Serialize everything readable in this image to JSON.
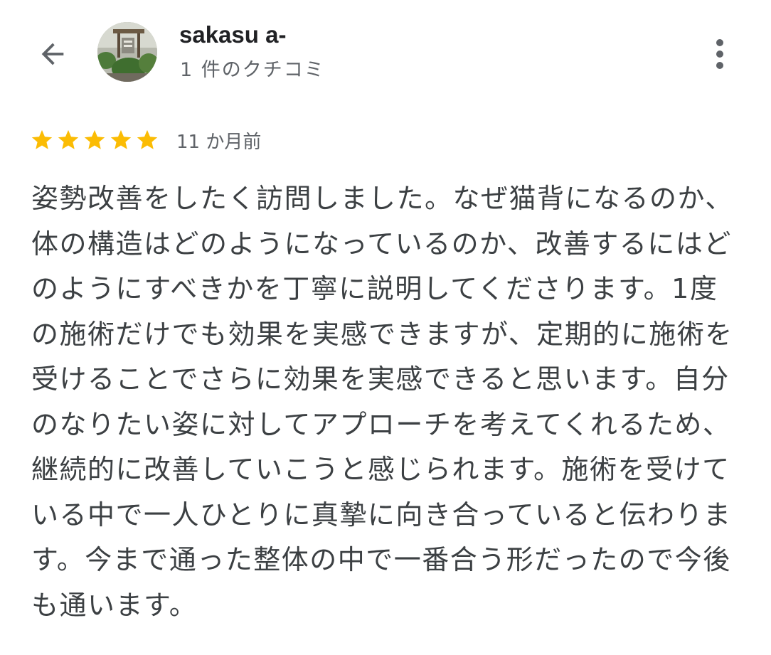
{
  "header": {
    "back_icon": "arrow-back-icon",
    "user_name": "sakasu a-",
    "review_count": "1 件のクチコミ",
    "more_icon": "more-vert-icon"
  },
  "review": {
    "rating": 5,
    "rating_max": 5,
    "star_color": "#FBBC04",
    "date": "11 か月前",
    "text": "姿勢改善をしたく訪問しました。なぜ猫背になるのか、体の構造はどのようになっているのか、改善するにはどのようにすべきかを丁寧に説明してくださります。1度の施術だけでも効果を実感できますが、定期的に施術を受けることでさらに効果を実感できると思います。自分のなりたい姿に対してアプローチを考えてくれるため、継続的に改善していこうと感じられます。施術を受けている中で一人ひとりに真摯に向き合っていると伝わります。今まで通った整体の中で一番合う形だったので今後も通います。"
  }
}
